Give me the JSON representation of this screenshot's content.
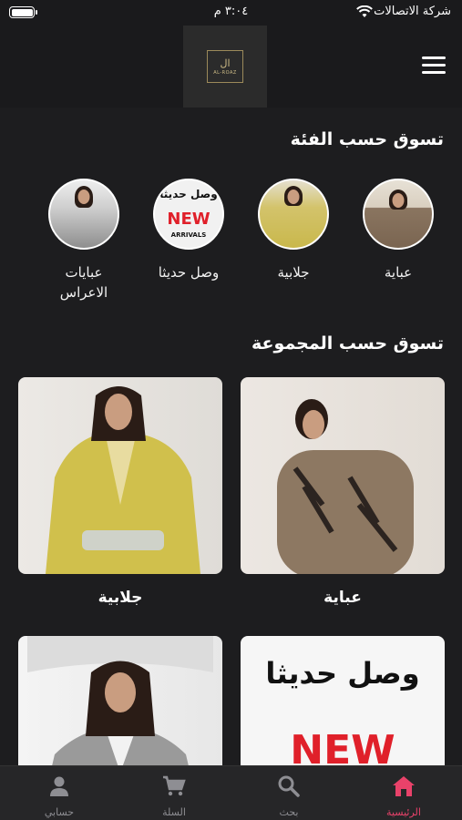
{
  "status_bar": {
    "carrier": "شركة الاتصالات",
    "time": "٣:٠٤ م"
  },
  "header": {
    "logo_text": "ال",
    "logo_subtext": "AL-ROAZ"
  },
  "categories_section": {
    "title": "تسوق حسب الفئة",
    "items": [
      {
        "label": "عباية"
      },
      {
        "label": "جلابية"
      },
      {
        "label": "وصل حديثا",
        "image_text_ar": "وصل حديثا",
        "image_text_en": "NEW",
        "image_text_sub": "ARRIVALS"
      },
      {
        "label": "عبايات الاعراس"
      }
    ]
  },
  "collections_section": {
    "title": "تسوق حسب المجموعة",
    "items": [
      {
        "label": "عباية"
      },
      {
        "label": "جلابية"
      },
      {
        "label": "",
        "image_text_ar": "وصل حديثا",
        "image_text_en": "NEW"
      },
      {
        "label": ""
      }
    ]
  },
  "tab_bar": {
    "tabs": [
      {
        "label": "الرئيسية",
        "icon": "home-icon",
        "active": true
      },
      {
        "label": "بحث",
        "icon": "search-icon",
        "active": false
      },
      {
        "label": "السلة",
        "icon": "cart-icon",
        "active": false
      },
      {
        "label": "حسابي",
        "icon": "person-icon",
        "active": false
      }
    ]
  },
  "colors": {
    "background": "#1d1d1f",
    "accent": "#e9426a",
    "new_red": "#e0202a"
  }
}
